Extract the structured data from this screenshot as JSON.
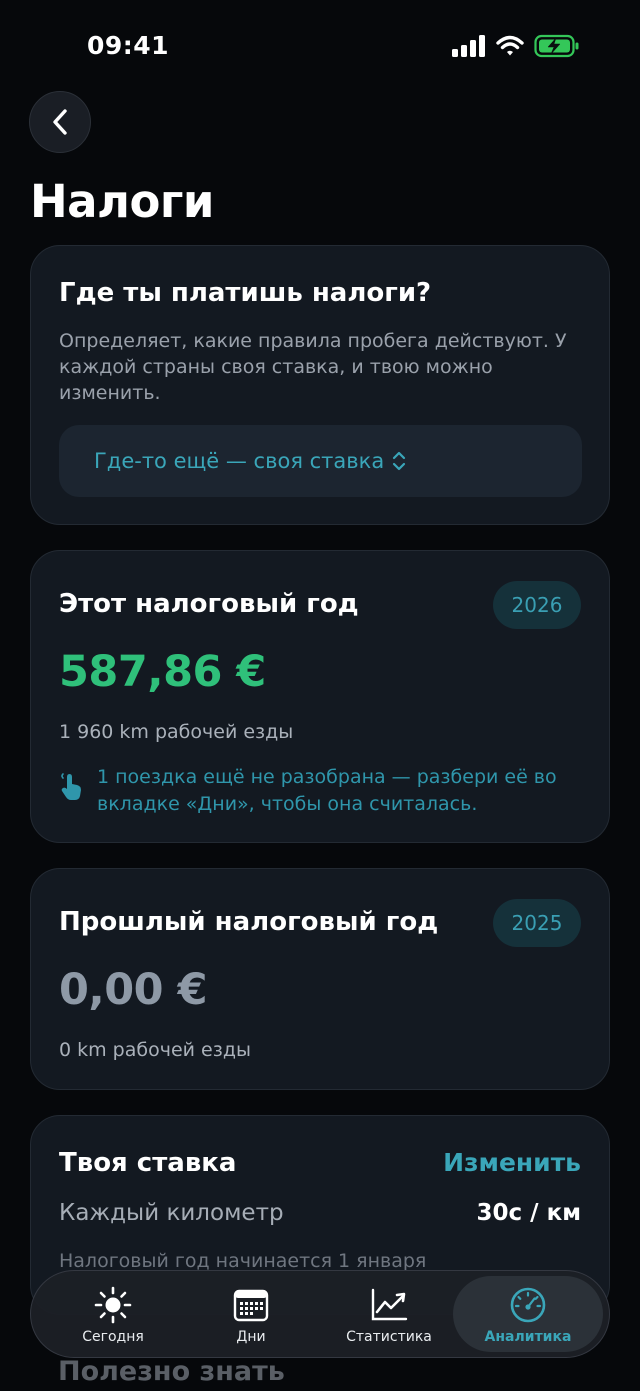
{
  "status": {
    "time": "09:41"
  },
  "page": {
    "title": "Налоги"
  },
  "tax_country": {
    "title": "Где ты платишь налоги?",
    "description": "Определяет, какие правила пробега действуют. У каждой страны своя ставка, и твою можно изменить.",
    "selected": "Где-то ещё — своя ставка"
  },
  "this_year": {
    "title": "Этот налоговый год",
    "year": "2026",
    "amount": "587,86 €",
    "distance": "1 960 km рабочей езды",
    "hint": "1 поездка ещё не разобрана — разбери её во вкладке «Дни», чтобы она считалась."
  },
  "last_year": {
    "title": "Прошлый налоговый год",
    "year": "2025",
    "amount": "0,00 €",
    "distance": "0 km рабочей езды"
  },
  "rate": {
    "title": "Твоя ставка",
    "change_label": "Изменить",
    "per_km_label": "Каждый километр",
    "per_km_value": "30c / км",
    "year_start": "Налоговый год начинается 1 января"
  },
  "next_section": {
    "title": "Полезно знать"
  },
  "tabbar": {
    "items": [
      {
        "label": "Сегодня",
        "icon": "sun-icon"
      },
      {
        "label": "Дни",
        "icon": "calendar-icon"
      },
      {
        "label": "Статистика",
        "icon": "chart-line-icon"
      },
      {
        "label": "Аналитика",
        "icon": "gauge-icon",
        "active": true
      }
    ]
  },
  "colors": {
    "accent": "#3aa6b9",
    "positive": "#2fc07a",
    "background": "#06080b",
    "card": "#131921"
  }
}
